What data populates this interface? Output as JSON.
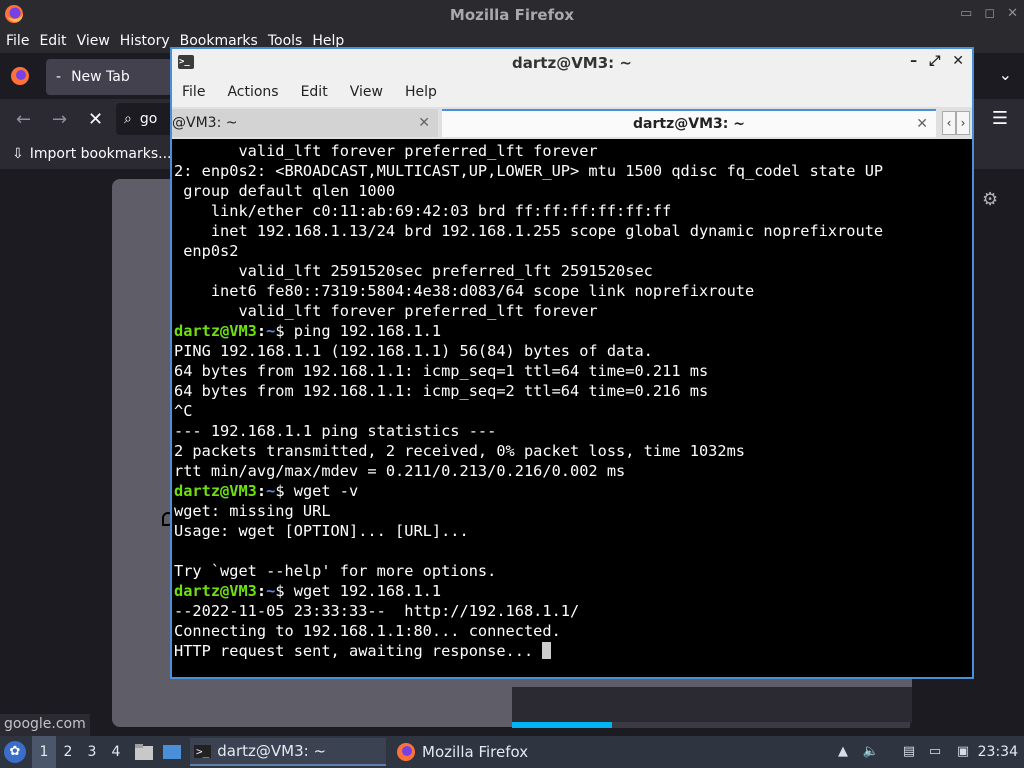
{
  "firefox": {
    "window_title": "Mozilla Firefox",
    "menu": [
      "File",
      "Edit",
      "View",
      "History",
      "Bookmarks",
      "Tools",
      "Help"
    ],
    "tab_label": "New Tab",
    "url_text": "go",
    "bookmark_label": "Import bookmarks...",
    "status_text": "google.com",
    "load_progress": 0.25
  },
  "terminal": {
    "window_title": "dartz@VM3: ~",
    "menu": [
      "File",
      "Actions",
      "Edit",
      "View",
      "Help"
    ],
    "tabs": [
      "@VM3: ~",
      "dartz@VM3: ~"
    ],
    "prompt_user": "dartz@VM3",
    "prompt_sep": ":",
    "prompt_path": "~",
    "prompt_end": "$ ",
    "lines": [
      {
        "t": "o",
        "text": "       valid_lft forever preferred_lft forever"
      },
      {
        "t": "o",
        "text": "2: enp0s2: <BROADCAST,MULTICAST,UP,LOWER_UP> mtu 1500 qdisc fq_codel state UP"
      },
      {
        "t": "o",
        "text": " group default qlen 1000"
      },
      {
        "t": "o",
        "text": "    link/ether c0:11:ab:69:42:03 brd ff:ff:ff:ff:ff:ff"
      },
      {
        "t": "o",
        "text": "    inet 192.168.1.13/24 brd 192.168.1.255 scope global dynamic noprefixroute"
      },
      {
        "t": "o",
        "text": " enp0s2"
      },
      {
        "t": "o",
        "text": "       valid_lft 2591520sec preferred_lft 2591520sec"
      },
      {
        "t": "o",
        "text": "    inet6 fe80::7319:5804:4e38:d083/64 scope link noprefixroute"
      },
      {
        "t": "o",
        "text": "       valid_lft forever preferred_lft forever"
      },
      {
        "t": "p",
        "text": "ping 192.168.1.1"
      },
      {
        "t": "o",
        "text": "PING 192.168.1.1 (192.168.1.1) 56(84) bytes of data."
      },
      {
        "t": "o",
        "text": "64 bytes from 192.168.1.1: icmp_seq=1 ttl=64 time=0.211 ms"
      },
      {
        "t": "o",
        "text": "64 bytes from 192.168.1.1: icmp_seq=2 ttl=64 time=0.216 ms"
      },
      {
        "t": "o",
        "text": "^C"
      },
      {
        "t": "o",
        "text": "--- 192.168.1.1 ping statistics ---"
      },
      {
        "t": "o",
        "text": "2 packets transmitted, 2 received, 0% packet loss, time 1032ms"
      },
      {
        "t": "o",
        "text": "rtt min/avg/max/mdev = 0.211/0.213/0.216/0.002 ms"
      },
      {
        "t": "p",
        "text": "wget -v"
      },
      {
        "t": "o",
        "text": "wget: missing URL"
      },
      {
        "t": "o",
        "text": "Usage: wget [OPTION]... [URL]..."
      },
      {
        "t": "o",
        "text": ""
      },
      {
        "t": "o",
        "text": "Try `wget --help' for more options."
      },
      {
        "t": "p",
        "text": "wget 192.168.1.1"
      },
      {
        "t": "o",
        "text": "--2022-11-05 23:33:33--  http://192.168.1.1/"
      },
      {
        "t": "o",
        "text": "Connecting to 192.168.1.1:80... connected."
      },
      {
        "t": "c",
        "text": "HTTP request sent, awaiting response... "
      }
    ]
  },
  "taskbar": {
    "workspaces": [
      "1",
      "2",
      "3",
      "4"
    ],
    "tasks": [
      "dartz@VM3: ~",
      "Mozilla Firefox"
    ],
    "clock": "23:34",
    "icons": [
      "start-menu-icon",
      "file-manager-icon",
      "desktop-icon",
      "volume-icon",
      "clipboard-icon",
      "network-icon",
      "update-icon"
    ]
  },
  "colors": {
    "prompt_user": "#6fe00f",
    "prompt_path": "#5b8ee6",
    "terminal_bg": "#000000",
    "active_border": "#4a90d9",
    "progress": "#00b3f4"
  }
}
